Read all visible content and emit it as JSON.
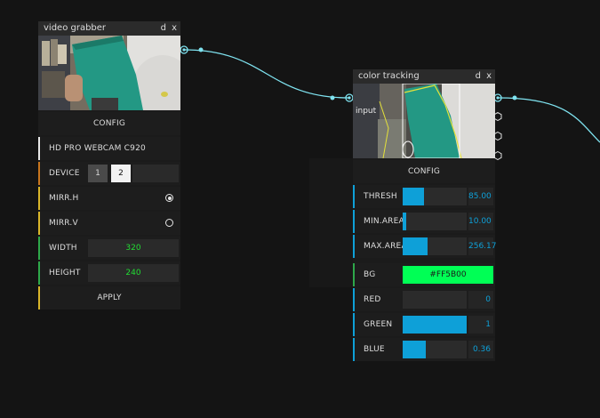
{
  "colors": {
    "wire": "#7fe3f0",
    "accent_blue": "#0ea0d8",
    "accent_orange": "#c8751e",
    "accent_yellow": "#d9b62a",
    "accent_green": "#2ea84a",
    "number_green": "#22dd33",
    "bg_color_value": "#00FF55"
  },
  "video_grabber": {
    "title": "video grabber",
    "btn_d": "d",
    "btn_x": "x",
    "config_label": "CONFIG",
    "camera_name": "HD PRO WEBCAM C920",
    "device_label": "DEVICE",
    "device_options": [
      "1",
      "2"
    ],
    "device_selected": "2",
    "mirr_h_label": "MIRR.H",
    "mirr_h_checked": true,
    "mirr_v_label": "MIRR.V",
    "mirr_v_checked": false,
    "width_label": "WIDTH",
    "width_value": "320",
    "height_label": "HEIGHT",
    "height_value": "240",
    "apply_label": "APPLY"
  },
  "color_tracking": {
    "title": "color tracking",
    "btn_d": "d",
    "btn_x": "x",
    "input_label": "input",
    "config_label": "CONFIG",
    "sliders": [
      {
        "label": "THRESH",
        "value": "85.00",
        "fraction": 0.33
      },
      {
        "label": "MIN.AREA",
        "value": "10.00",
        "fraction": 0.06
      },
      {
        "label": "MAX.AREA",
        "value": "256.17",
        "fraction": 0.39
      }
    ],
    "bg_label": "BG",
    "bg_value": "#FF5B00",
    "channels": [
      {
        "label": "RED",
        "value": "0",
        "fraction": 0.0
      },
      {
        "label": "GREEN",
        "value": "1",
        "fraction": 1.0
      },
      {
        "label": "BLUE",
        "value": "0.36",
        "fraction": 0.36
      }
    ]
  }
}
